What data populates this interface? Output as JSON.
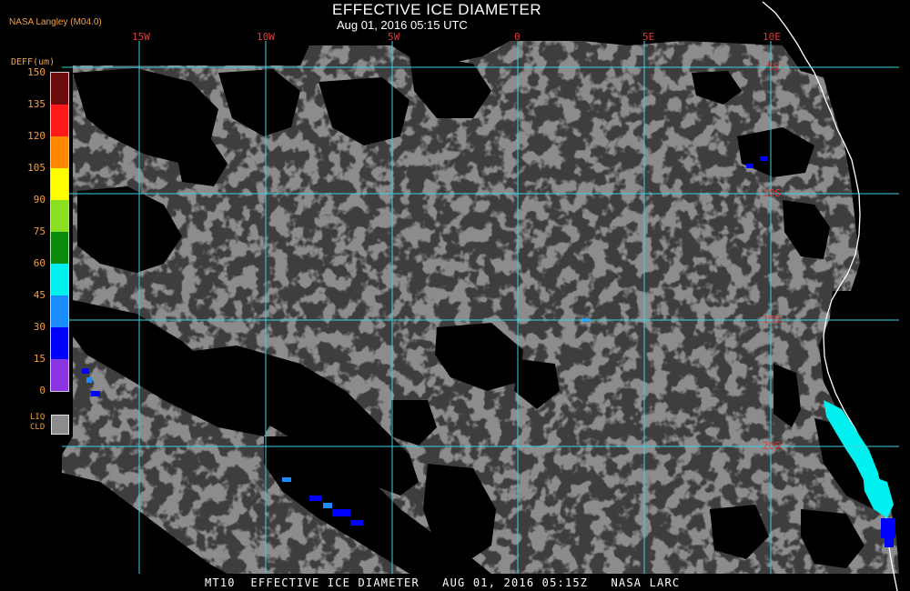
{
  "header": {
    "title": "EFFECTIVE ICE DIAMETER",
    "subtitle": "Aug 01, 2016 05:15 UTC",
    "credit": "NASA Langley (M04.0)"
  },
  "footer": {
    "caption": "MT10  EFFECTIVE ICE DIAMETER   AUG 01, 2016 05:15Z   NASA LARC"
  },
  "legend": {
    "title": "DEFF(um)",
    "ticks": [
      "150",
      "135",
      "120",
      "105",
      "90",
      "75",
      "60",
      "45",
      "30",
      "15",
      "0"
    ],
    "colors": [
      "#6b0b0b",
      "#ff1a1a",
      "#ff8800",
      "#ffff00",
      "#88e020",
      "#0a8a0a",
      "#00f0f0",
      "#1a8cff",
      "#0000ff",
      "#8a35e0"
    ],
    "liq_label_1": "LIQ",
    "liq_label_2": "CLD",
    "liq_color": "#8c8c8c"
  },
  "map": {
    "lon_labels": [
      "15W",
      "10W",
      "5W",
      "0",
      "5E",
      "10E"
    ],
    "lat_labels": [
      "5S",
      "10S",
      "15S",
      "20S"
    ],
    "grid_color": "#40d0e0",
    "cloud_color": "#8c8c8c",
    "coast_color": "#ffffff",
    "cyan_color": "#00f0f0",
    "blue_color": "#0000ff"
  }
}
